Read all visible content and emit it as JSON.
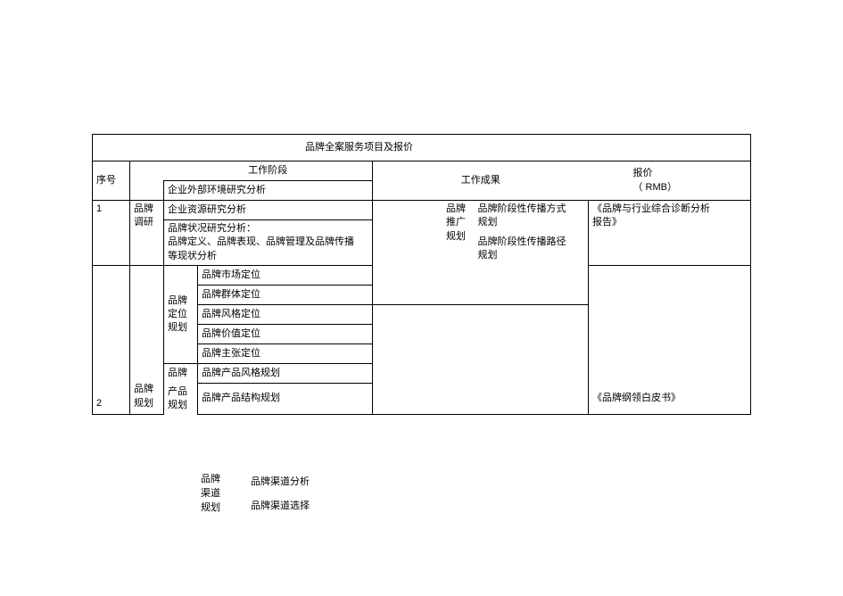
{
  "title": "品牌全案服务项目及报价",
  "header": {
    "seq": "序号",
    "stage": "工作阶段",
    "result": "工作成果",
    "price": "报价",
    "price_sub": "（ RMB）"
  },
  "rows": {
    "seq1": "1",
    "cat1": "品牌\n调研",
    "a1": "企业外部环境研究分析",
    "a2": "企业资源研究分析",
    "a3": "品牌状况研究分析：\n品牌定义、品牌表现、品牌管理及品牌传播\n等现状分析",
    "res1_a": "品牌\n推广\n规划",
    "res1_b1": "品牌阶段性传播方式\n规划",
    "res1_b2": "品牌阶段性传播路径\n规划",
    "price1": "《品牌与行业综合诊断分析\n报告》",
    "seq2": "2",
    "cat2": "品牌\n规划",
    "sub_pos": "品牌\n定位\n规划",
    "p1": "品牌市场定位",
    "p2": "品牌群体定位",
    "p3": "品牌风格定位",
    "p4": "品牌价值定位",
    "p5": "品牌主张定位",
    "sub_brand": "品牌",
    "b1": "品牌产品风格规划",
    "sub_prod": "产品\n规划",
    "b2": "品牌产品结构规划",
    "sub_channel": "品牌\n渠道\n规划",
    "c1": "品牌渠道分析",
    "c2": "品牌渠道选择",
    "price2": "《品牌纲领白皮书》"
  }
}
